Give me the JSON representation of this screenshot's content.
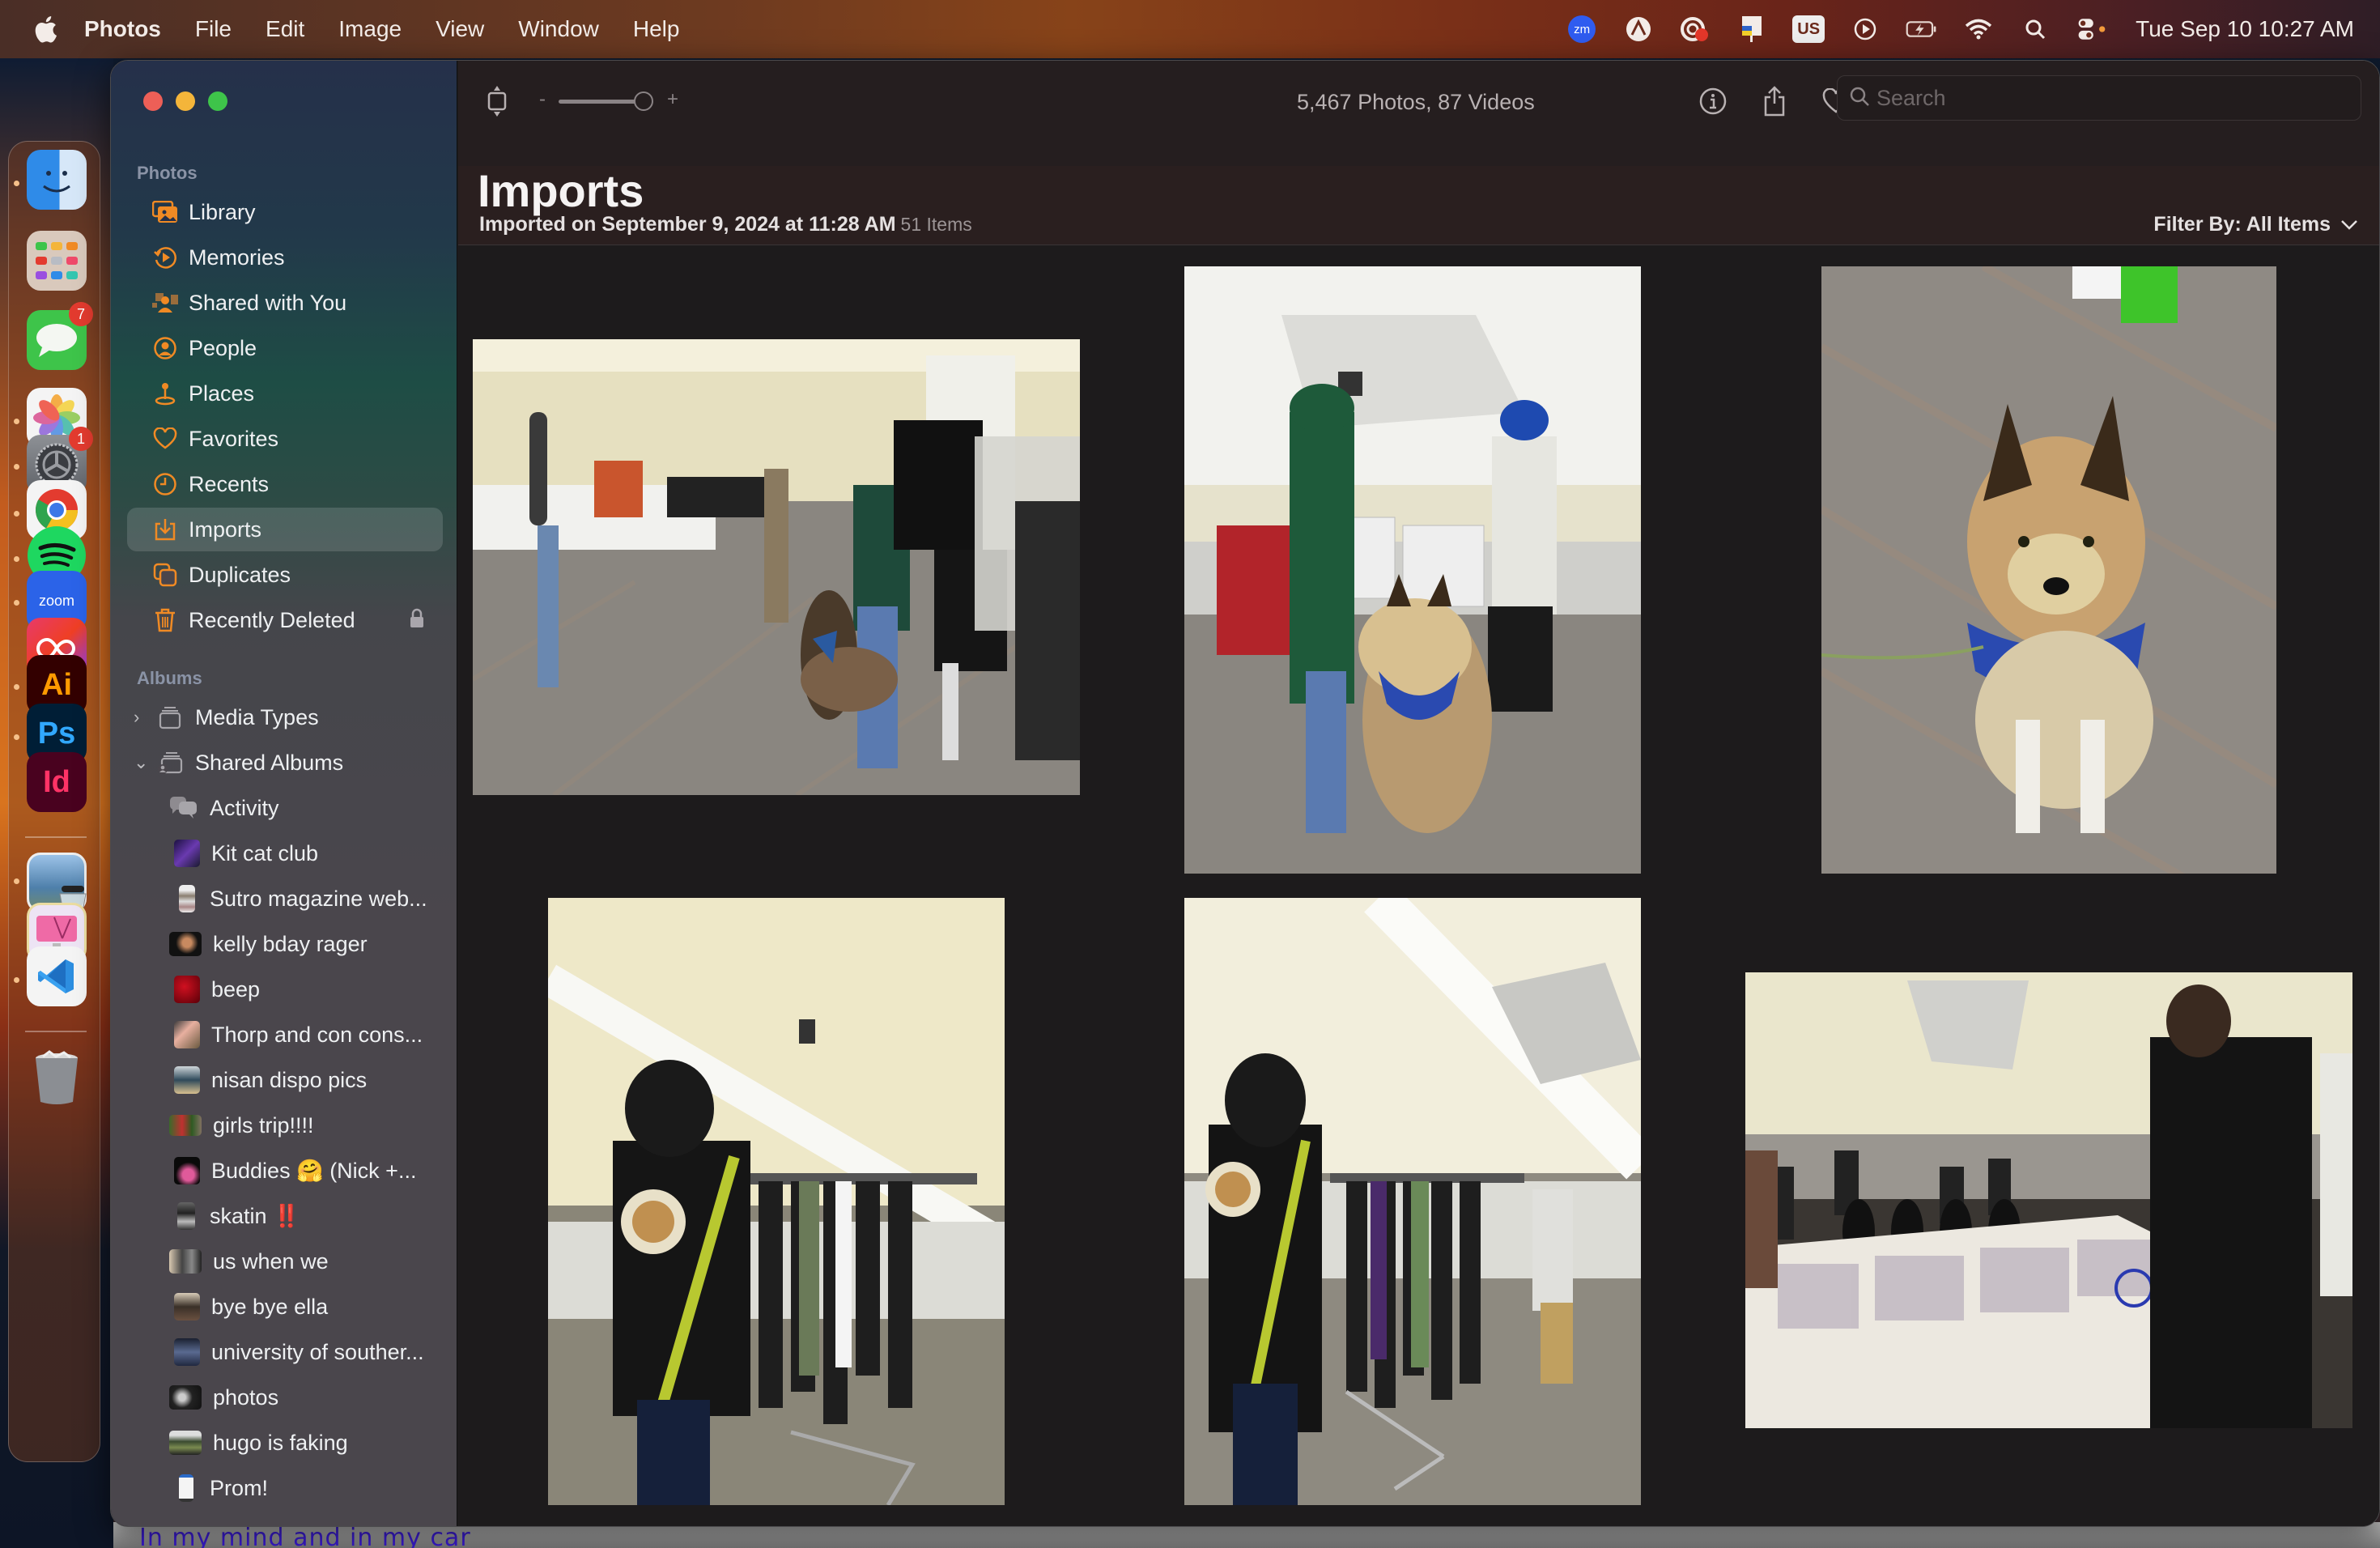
{
  "menubar": {
    "apple_icon": "apple-logo-icon",
    "app_name": "Photos",
    "items": [
      "File",
      "Edit",
      "Image",
      "View",
      "Window",
      "Help"
    ],
    "status_icons": [
      "zoom-icon",
      "creative-cloud-sync-icon",
      "cloud-record-icon",
      "preview-flag-icon",
      "input-source-icon",
      "play-circle-icon",
      "battery-charging-icon",
      "wifi-icon",
      "spotlight-search-icon",
      "control-center-icon"
    ],
    "input_source": "US",
    "zoom_label": "zm",
    "clock": "Tue Sep 10  10:27 AM"
  },
  "dock": {
    "apps": [
      {
        "name": "Finder",
        "running": true
      },
      {
        "name": "Launchpad",
        "running": false
      },
      {
        "name": "Messages",
        "running": false,
        "badge": "7"
      },
      {
        "name": "Photos",
        "running": true
      },
      {
        "name": "System Settings",
        "running": true,
        "badge": "1"
      },
      {
        "name": "Google Chrome",
        "running": true
      },
      {
        "name": "Spotify",
        "running": true
      },
      {
        "name": "Zoom",
        "running": true,
        "label": "zoom"
      },
      {
        "name": "Creative Cloud",
        "running": false
      },
      {
        "name": "Adobe Illustrator",
        "running": true,
        "label": "Ai"
      },
      {
        "name": "Adobe Photoshop",
        "running": true,
        "label": "Ps"
      },
      {
        "name": "Adobe InDesign",
        "running": false,
        "label": "Id"
      },
      {
        "name": "Preview",
        "running": true
      },
      {
        "name": "CleanMyMac",
        "running": false
      },
      {
        "name": "Visual Studio Code",
        "running": true
      },
      {
        "name": "Trash",
        "running": false
      }
    ]
  },
  "sidebar": {
    "photos_heading": "Photos",
    "photos_items": [
      {
        "label": "Library",
        "icon": "library-icon"
      },
      {
        "label": "Memories",
        "icon": "memories-icon"
      },
      {
        "label": "Shared with You",
        "icon": "shared-with-you-icon"
      },
      {
        "label": "People",
        "icon": "people-icon"
      },
      {
        "label": "Places",
        "icon": "places-icon"
      },
      {
        "label": "Favorites",
        "icon": "heart-icon"
      },
      {
        "label": "Recents",
        "icon": "clock-icon"
      },
      {
        "label": "Imports",
        "icon": "import-icon",
        "selected": true
      },
      {
        "label": "Duplicates",
        "icon": "duplicates-icon"
      },
      {
        "label": "Recently Deleted",
        "icon": "trash-icon",
        "locked": true
      }
    ],
    "albums_heading": "Albums",
    "albums": [
      {
        "label": "Media Types",
        "expanded": false
      },
      {
        "label": "Shared Albums",
        "expanded": true
      }
    ],
    "shared_albums": [
      {
        "label": "Activity",
        "icon": "activity-icon"
      },
      {
        "label": "Kit cat club"
      },
      {
        "label": "Sutro magazine web..."
      },
      {
        "label": "kelly bday rager"
      },
      {
        "label": "beep"
      },
      {
        "label": "Thorp and con cons..."
      },
      {
        "label": "nisan dispo pics"
      },
      {
        "label": "girls trip!!!!"
      },
      {
        "label": "Buddies 🤗 (Nick +..."
      },
      {
        "label": "skatin ‼️"
      },
      {
        "label": "us when we"
      },
      {
        "label": "bye bye ella"
      },
      {
        "label": "university of souther..."
      },
      {
        "label": "photos"
      },
      {
        "label": "hugo is faking"
      },
      {
        "label": "Prom!"
      }
    ]
  },
  "toolbar": {
    "counts": "5,467 Photos, 87 Videos",
    "zoom_minus": "-",
    "zoom_plus": "+",
    "zoom_level": 0.95,
    "search_placeholder": "Search",
    "search_value": ""
  },
  "header": {
    "title": "Imports",
    "subtitle": "Imported on September 9, 2024 at 11:28 AM",
    "item_count": "51 Items",
    "filter_label": "Filter By: All Items"
  },
  "photos": [
    {
      "id": "photo-1",
      "description": "record fair crowd with dog lying on carpet",
      "orientation": "landscape"
    },
    {
      "id": "photo-2",
      "description": "woman in green cap petting German shepherd",
      "orientation": "portrait"
    },
    {
      "id": "photo-3",
      "description": "German shepherd with blue bandana looking up",
      "orientation": "portrait"
    },
    {
      "id": "photo-4",
      "description": "man browsing t-shirt rack",
      "orientation": "portrait"
    },
    {
      "id": "photo-5",
      "description": "man at clothing rack from behind",
      "orientation": "portrait"
    },
    {
      "id": "photo-6",
      "description": "man browsing CD bins at record fair",
      "orientation": "landscape"
    }
  ],
  "desktop": {
    "background_text": "In my mind and in my car"
  }
}
